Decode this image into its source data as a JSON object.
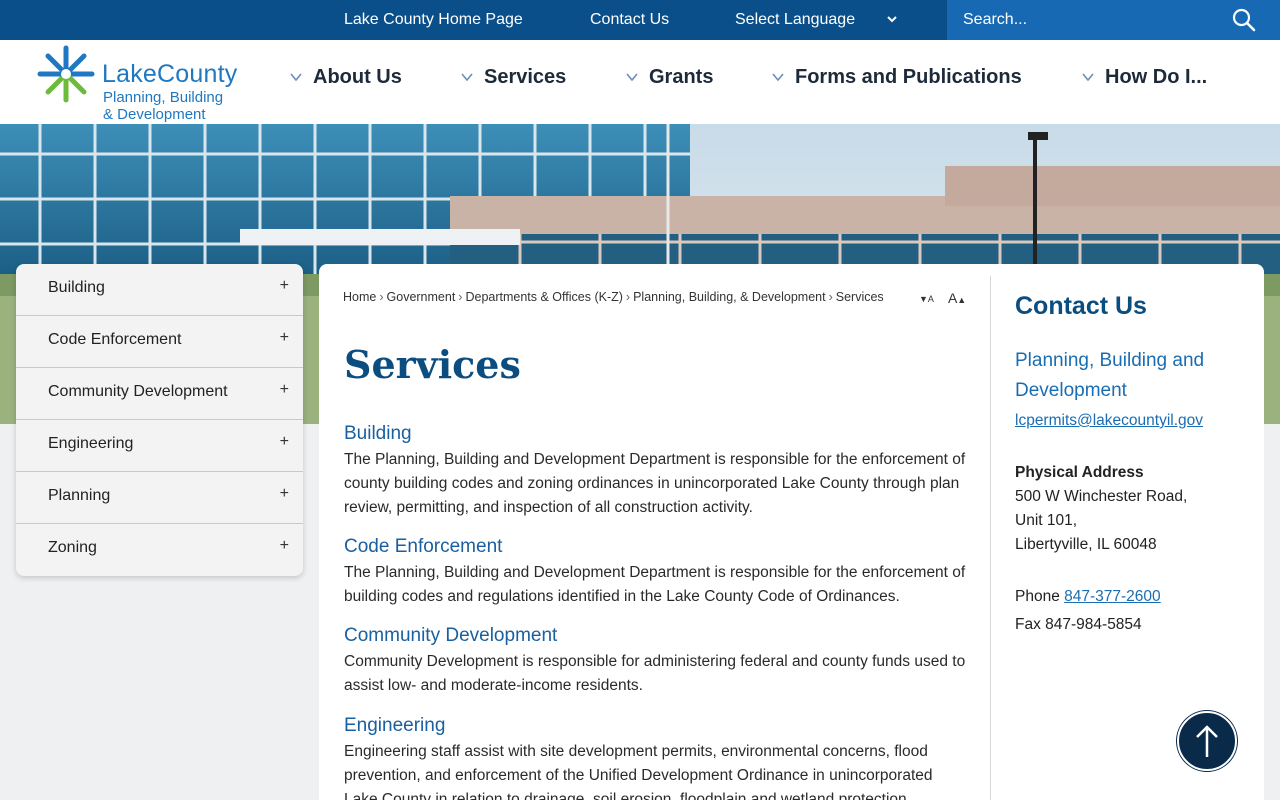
{
  "utility": {
    "home_link": "Lake County Home Page",
    "contact_link": "Contact Us",
    "language": "Select Language",
    "search_placeholder": "Search..."
  },
  "logo": {
    "name": "LakeCounty",
    "sub1": "Planning, Building",
    "sub2": "& Development"
  },
  "nav": {
    "items": [
      {
        "label": "About Us"
      },
      {
        "label": "Services"
      },
      {
        "label": "Grants"
      },
      {
        "label": "Forms and Publications"
      },
      {
        "label": "How Do I..."
      }
    ]
  },
  "sidenav": {
    "items": [
      {
        "label": "Building",
        "toggle": "+"
      },
      {
        "label": "Code Enforcement",
        "toggle": "+"
      },
      {
        "label": "Community Development",
        "toggle": "+"
      },
      {
        "label": "Engineering",
        "toggle": "+"
      },
      {
        "label": "Planning",
        "toggle": "+"
      },
      {
        "label": "Zoning",
        "toggle": "+"
      }
    ]
  },
  "breadcrumb": {
    "items": [
      "Home",
      "Government",
      "Departments & Offices (K-Z)",
      "Planning, Building, & Development",
      "Services"
    ],
    "separator": "›"
  },
  "font_tools": {
    "decrease": "A",
    "increase": "A"
  },
  "main": {
    "title": "Services",
    "sections": [
      {
        "title": "Building",
        "text": "The Planning, Building and Development Department is responsible for the enforcement of county building codes and zoning ordinances in unincorporated Lake County through plan review, permitting, and inspection of all construction activity."
      },
      {
        "title": "Code Enforcement",
        "text": "The Planning, Building and Development Department is responsible for the enforcement of building codes and regulations identified in the Lake County Code of Ordinances."
      },
      {
        "title": "Community Development",
        "text": "Community Development is responsible for administering federal and county funds used to assist low- and moderate-income residents."
      },
      {
        "title": "Engineering",
        "text": "Engineering staff assist with site development permits, environmental concerns, flood prevention, and enforcement of the Unified Development Ordinance in unincorporated Lake County in relation to drainage, soil erosion, floodplain and wetland protection."
      }
    ]
  },
  "contact": {
    "heading": "Contact Us",
    "department": "Planning, Building and Development",
    "email": "lcpermits@lakecountyil.gov",
    "address_heading": "Physical Address",
    "address_lines": [
      "500 W Winchester Road,",
      "Unit 101,",
      "Libertyville, IL 60048"
    ],
    "phone_label": "Phone",
    "phone": "847-377-2600",
    "fax": "Fax 847-984-5854"
  },
  "colors": {
    "utility_bar": "#0b4f8a",
    "search_bg": "#1769b3",
    "heading": "#0c4d80",
    "link": "#1a6db3"
  }
}
